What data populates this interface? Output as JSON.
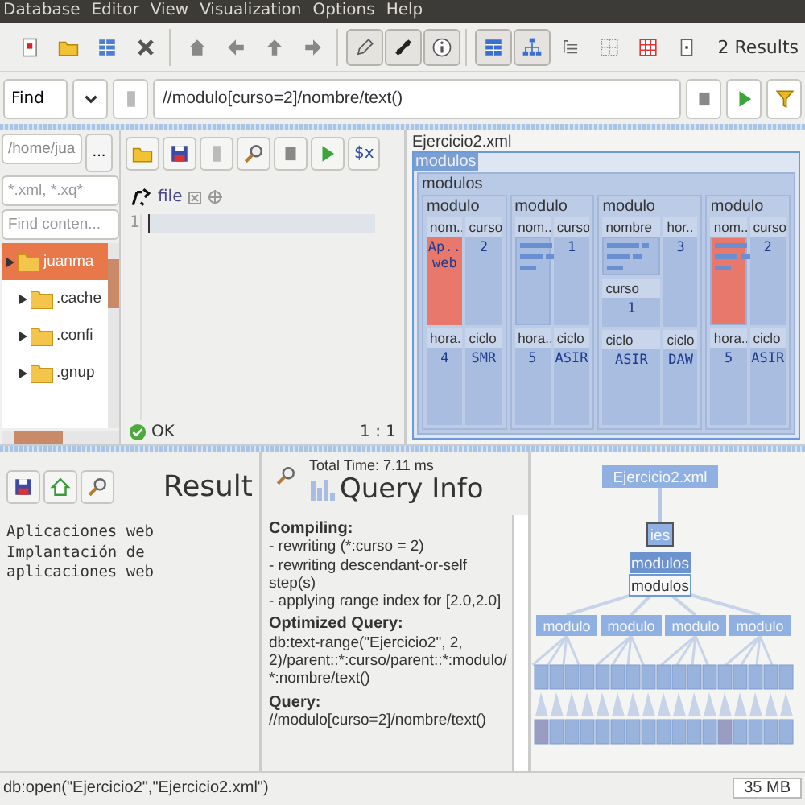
{
  "menu": [
    "Database",
    "Editor",
    "View",
    "Visualization",
    "Options",
    "Help"
  ],
  "toolbar": {
    "groups": [
      [
        {
          "kind": "new",
          "pressed": false
        },
        {
          "kind": "open",
          "pressed": false
        },
        {
          "kind": "properties",
          "pressed": false
        },
        {
          "kind": "close",
          "pressed": false
        }
      ],
      [
        {
          "kind": "home",
          "pressed": false
        },
        {
          "kind": "back",
          "pressed": false
        },
        {
          "kind": "up",
          "pressed": false
        },
        {
          "kind": "forward",
          "pressed": false
        }
      ],
      [
        {
          "kind": "edit",
          "pressed": true
        },
        {
          "kind": "link",
          "pressed": true
        },
        {
          "kind": "info",
          "pressed": true
        }
      ],
      [
        {
          "kind": "map",
          "pressed": true
        },
        {
          "kind": "tree",
          "pressed": true
        },
        {
          "kind": "folder",
          "pressed": false
        },
        {
          "kind": "plot",
          "pressed": false
        },
        {
          "kind": "table",
          "pressed": false
        },
        {
          "kind": "explore",
          "pressed": false
        }
      ]
    ],
    "results": "2 Results"
  },
  "query_bar": {
    "mode": "Find",
    "value": "//modulo[curso=2]/nombre/text()"
  },
  "file_browser": {
    "path": "/home/jua",
    "browse": "...",
    "filter_placeholder": "*.xml, *.xq*",
    "search_placeholder": "Find conten...",
    "tree": [
      {
        "name": "juanma",
        "selected": true,
        "children": [
          {
            "name": ".cache",
            "selected": false
          },
          {
            "name": ".confi",
            "selected": false
          },
          {
            "name": ".gnup",
            "selected": false
          }
        ]
      }
    ]
  },
  "editor": {
    "var_button": "$x",
    "tab": "file",
    "line_numbers": [
      "1"
    ],
    "status": "OK",
    "position": "1 : 1"
  },
  "map": {
    "title": "Ejercicio2.xml",
    "root": {
      "label": "modulos",
      "selected": true
    },
    "container_label": "modulos",
    "modules": [
      {
        "label": "modulo",
        "fields": [
          {
            "label": "nom..",
            "kind": "text",
            "value": "Ap.. web",
            "highlighted": true
          },
          {
            "label": "curso",
            "kind": "text",
            "value": "2",
            "highlighted": false
          },
          {
            "label": "hora..",
            "kind": "text",
            "value": "4",
            "highlighted": false
          },
          {
            "label": "ciclo",
            "kind": "text",
            "value": "SMR",
            "highlighted": false
          }
        ]
      },
      {
        "label": "modulo",
        "fields": [
          {
            "label": "nom..",
            "kind": "bars",
            "highlighted": false
          },
          {
            "label": "curso",
            "kind": "text",
            "value": "1",
            "highlighted": false
          },
          {
            "label": "hora..",
            "kind": "text",
            "value": "5",
            "highlighted": false
          },
          {
            "label": "ciclo",
            "kind": "text",
            "value": "ASIR",
            "highlighted": false
          }
        ]
      },
      {
        "label": "modulo",
        "fields": [
          {
            "label": "nombre",
            "kind": "bars",
            "highlighted": false
          },
          {
            "label": "hor..",
            "kind": "text",
            "value": "3",
            "highlighted": false
          },
          {
            "label": "curso",
            "kind": "text",
            "value": "1",
            "highlighted": false
          },
          {
            "label": "ciclo",
            "kind": "text",
            "value": "ASIR",
            "highlighted": false
          },
          {
            "label": "ciclo",
            "kind": "text",
            "value": "DAW",
            "highlighted": false
          }
        ]
      },
      {
        "label": "modulo",
        "fields": [
          {
            "label": "nom..",
            "kind": "bars",
            "highlighted": true
          },
          {
            "label": "curso",
            "kind": "text",
            "value": "2",
            "highlighted": false
          },
          {
            "label": "hora..",
            "kind": "text",
            "value": "5",
            "highlighted": false
          },
          {
            "label": "ciclo",
            "kind": "text",
            "value": "ASIR",
            "highlighted": false
          }
        ]
      }
    ]
  },
  "result": {
    "title": "Result",
    "lines": [
      "Aplicaciones web",
      "Implantación de aplicaciones web"
    ]
  },
  "query_info": {
    "title": "Query Info",
    "total_time": "Total Time: 7.11 ms",
    "sections": [
      {
        "heading": "Compiling:",
        "lines": [
          "- rewriting (*:curso = 2)",
          "- rewriting descendant-or-self step(s)",
          "- applying range index for [2.0,2.0]"
        ]
      },
      {
        "heading": "Optimized Query:",
        "lines": [
          "db:text-range(\"Ejercicio2\", 2, 2)/parent::*:curso/parent::*:modulo/*:nombre/text()"
        ]
      },
      {
        "heading": "Query:",
        "lines": [
          "//modulo[curso=2]/nombre/text()"
        ]
      }
    ]
  },
  "tree_view": {
    "label": "Ejercicio2.xml",
    "children": [
      {
        "label": "ies",
        "children": [
          {
            "label": "modulos",
            "selected": true,
            "tooltip": "modulos",
            "children": [
              {
                "label": "modulo"
              },
              {
                "label": "modulo"
              },
              {
                "label": "modulo"
              },
              {
                "label": "modulo"
              }
            ]
          }
        ]
      }
    ]
  },
  "status_bar": {
    "command": "db:open(\"Ejercicio2\",\"Ejercicio2.xml\")",
    "memory": "35 MB"
  }
}
